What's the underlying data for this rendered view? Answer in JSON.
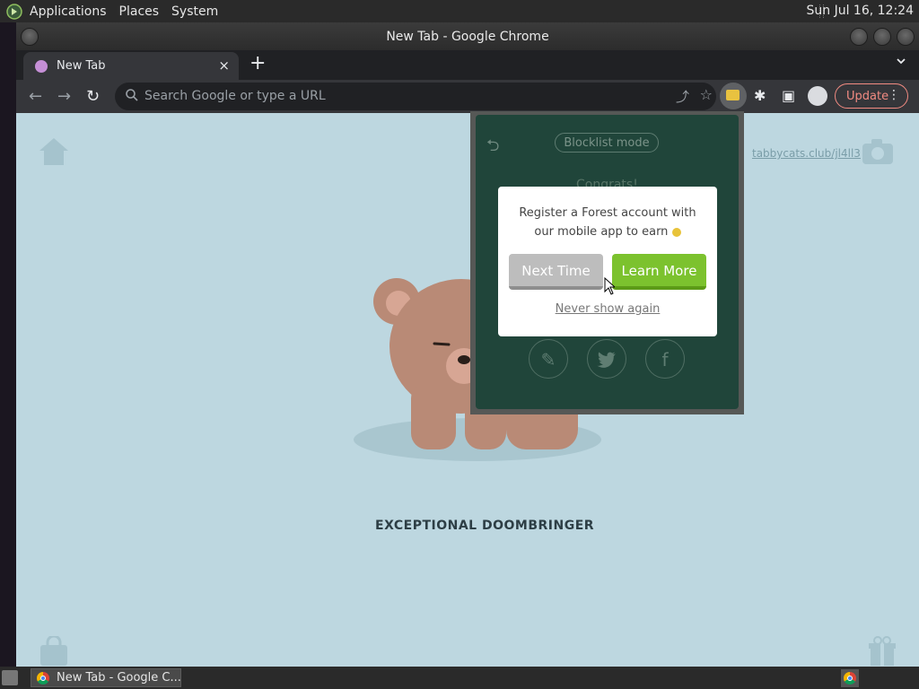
{
  "top_panel": {
    "menus": [
      "Applications",
      "Places",
      "System"
    ],
    "clock": "Sun Jul 16, 12:24"
  },
  "window": {
    "title": "New Tab - Google Chrome"
  },
  "tab": {
    "title": "New Tab",
    "close": "×"
  },
  "new_tab_glyph": "+",
  "tab_list_glyph": "⌄",
  "toolbar": {
    "back": "←",
    "forward": "→",
    "reload": "↻",
    "omnibox_placeholder": "Search Google or type a URL",
    "update_label": "Update"
  },
  "page": {
    "link_text": "tabbycats.club/jl4ll3",
    "bear_name": "EXCEPTIONAL DOOMBRINGER"
  },
  "forest_popup": {
    "mode_label": "Blocklist mode",
    "congrats": "Congrats!",
    "share_icons": [
      "pencil-icon",
      "twitter-icon",
      "facebook-icon"
    ]
  },
  "dialog": {
    "line1": "Register a Forest account with",
    "line2": "our mobile app to earn",
    "next_time": "Next Time",
    "learn_more": "Learn More",
    "never_show": "Never show again"
  },
  "taskbar": {
    "item_label": "New Tab - Google C..."
  },
  "colors": {
    "page_bg": "#bdd7e0",
    "popup_bg": "#20453a",
    "learn_more": "#7cc22e",
    "next_time": "#bdbdbd",
    "update_accent": "#f28b82"
  }
}
